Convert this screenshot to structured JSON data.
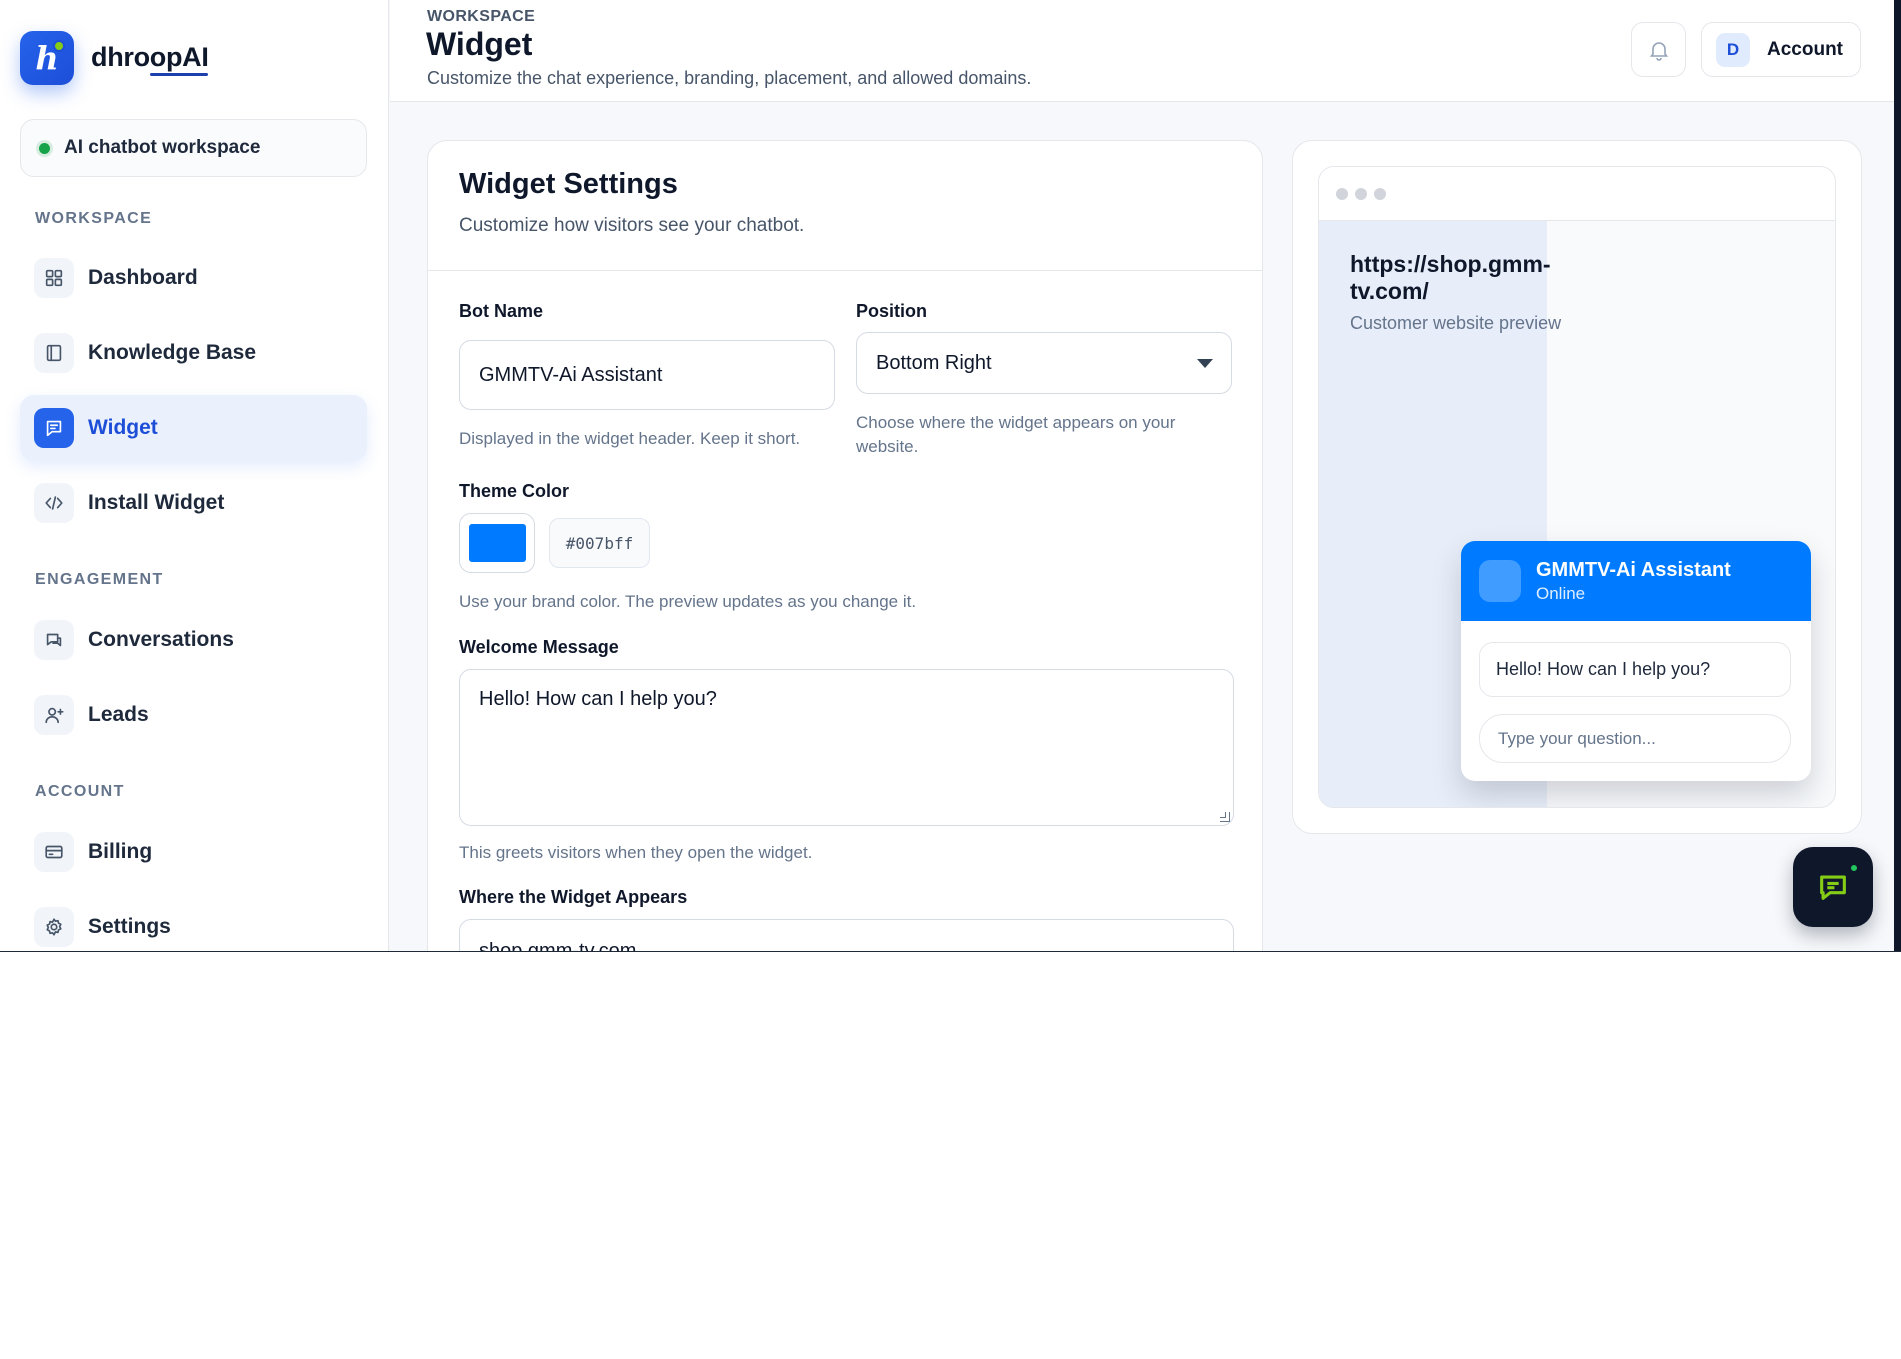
{
  "brand": {
    "name": "dhroopAI",
    "logo_letter": "h"
  },
  "workspace_pill": {
    "label": "AI chatbot workspace",
    "status_color": "#16a34a"
  },
  "sidebar": {
    "section_workspace": "WORKSPACE",
    "section_engagement": "ENGAGEMENT",
    "section_account": "ACCOUNT",
    "items": [
      {
        "label": "Dashboard",
        "icon": "grid-icon"
      },
      {
        "label": "Knowledge Base",
        "icon": "book-icon"
      },
      {
        "label": "Widget",
        "icon": "chat-icon",
        "active": true
      },
      {
        "label": "Install Widget",
        "icon": "code-icon"
      },
      {
        "label": "Conversations",
        "icon": "conversation-icon"
      },
      {
        "label": "Leads",
        "icon": "user-plus-icon"
      },
      {
        "label": "Billing",
        "icon": "card-icon"
      },
      {
        "label": "Settings",
        "icon": "gear-icon"
      }
    ]
  },
  "header": {
    "breadcrumb": "WORKSPACE",
    "title": "Widget",
    "subtitle": "Customize the chat experience, branding, placement, and allowed domains.",
    "account_label": "Account",
    "account_initial": "D"
  },
  "form": {
    "title": "Widget Settings",
    "subtitle": "Customize how visitors see your chatbot.",
    "bot_name_label": "Bot Name",
    "bot_name_value": "GMMTV-Ai Assistant",
    "bot_name_help": "Displayed in the widget header. Keep it short.",
    "position_label": "Position",
    "position_value": "Bottom Right",
    "position_help": "Choose where the widget appears on your website.",
    "theme_label": "Theme Color",
    "theme_value": "#007bff",
    "theme_help": "Use your brand color. The preview updates as you change it.",
    "welcome_label": "Welcome Message",
    "welcome_value": "Hello! How can I help you?",
    "welcome_help": "This greets visitors when they open the widget.",
    "domains_label": "Where the Widget Appears",
    "domains_value": "shop.gmm-tv.com"
  },
  "preview": {
    "site_url": "https://shop.gmm-tv.com/",
    "site_caption": "Customer website preview",
    "chat_name": "GMMTV-Ai Assistant",
    "chat_status": "Online",
    "chat_greeting": "Hello! How can I help you?",
    "chat_placeholder": "Type your question..."
  },
  "colors": {
    "accent": "#2563eb",
    "theme": "#007bff",
    "fab": "#0f172a"
  }
}
